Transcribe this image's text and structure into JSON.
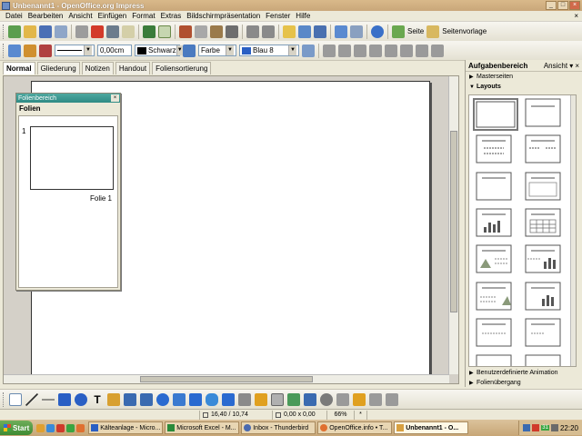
{
  "window": {
    "title": "Unbenannt1 - OpenOffice.org Impress",
    "min": "_",
    "max": "□",
    "close": "×"
  },
  "menu": [
    "Datei",
    "Bearbeiten",
    "Ansicht",
    "Einfügen",
    "Format",
    "Extras",
    "Bildschirmpräsentation",
    "Fenster",
    "Hilfe"
  ],
  "menu_close": "×",
  "toolbar1": {
    "seite_label": "Seite",
    "seitenvorlage_label": "Seitenvorlage"
  },
  "toolbar2": {
    "line_width": "0,00cm",
    "line_color": "Schwarz",
    "area_style": "Farbe",
    "area_color": "Blau 8"
  },
  "view_tabs": [
    "Normal",
    "Gliederung",
    "Notizen",
    "Handout",
    "Foliensortierung"
  ],
  "slide_panel": {
    "title": "Folienbereich",
    "heading": "Folien",
    "slide_number": "1",
    "slide_label": "Folie 1",
    "close": "×"
  },
  "task_panel": {
    "title": "Aufgabenbereich",
    "view": "Ansicht ▾",
    "close": "×",
    "section_masterseiten": "Masterseiten",
    "section_layouts": "Layouts",
    "section_animation": "Benutzerdefinierte Animation",
    "section_uebergang": "Folienübergang"
  },
  "statusbar": {
    "position": "16,40 / 10,74",
    "size": "0,00 x 0,00",
    "zoom": "66%",
    "mark": "*"
  },
  "taskbar": {
    "start": "Start",
    "tasks": [
      "Kälteanlage - Micro...",
      "Microsoft Excel - M...",
      "Inbox - Thunderbird",
      "OpenOffice.info • T...",
      "Unbenannt1 - O..."
    ],
    "clock": "22:20",
    "tray_day": "31"
  },
  "colors": {
    "line_swatch": "#000000",
    "area_swatch": "#2a5fc4"
  }
}
